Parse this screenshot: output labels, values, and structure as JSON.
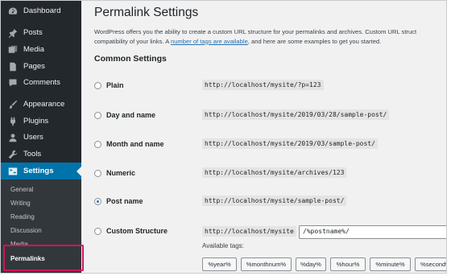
{
  "sidebar": {
    "items": [
      {
        "label": "Dashboard",
        "icon": "dashboard-icon"
      },
      {
        "label": "Posts",
        "icon": "pin-icon"
      },
      {
        "label": "Media",
        "icon": "media-icon"
      },
      {
        "label": "Pages",
        "icon": "pages-icon"
      },
      {
        "label": "Comments",
        "icon": "comments-icon"
      },
      {
        "label": "Appearance",
        "icon": "paintbrush-icon"
      },
      {
        "label": "Plugins",
        "icon": "plugin-icon"
      },
      {
        "label": "Users",
        "icon": "users-icon"
      },
      {
        "label": "Tools",
        "icon": "wrench-icon"
      },
      {
        "label": "Settings",
        "icon": "settings-icon"
      }
    ],
    "submenu": [
      "General",
      "Writing",
      "Reading",
      "Discussion",
      "Media",
      "Permalinks"
    ],
    "active_submenu": "Permalinks",
    "accent_color": "#0073aa",
    "highlight_color": "#d0155a"
  },
  "main": {
    "title": "Permalink Settings",
    "intro_line1": "WordPress offers you the ability to create a custom URL structure for your permalinks and archives. Custom URL struct",
    "intro_line2_pre": "compatibility of your links. A ",
    "intro_link": "number of tags are available",
    "intro_line2_post": ", and here are some examples to get you started.",
    "section_title": "Common Settings",
    "options": [
      {
        "label": "Plain",
        "example": "http://localhost/mysite/?p=123",
        "checked": false
      },
      {
        "label": "Day and name",
        "example": "http://localhost/mysite/2019/03/28/sample-post/",
        "checked": false
      },
      {
        "label": "Month and name",
        "example": "http://localhost/mysite/2019/03/sample-post/",
        "checked": false
      },
      {
        "label": "Numeric",
        "example": "http://localhost/mysite/archives/123",
        "checked": false
      },
      {
        "label": "Post name",
        "example": "http://localhost/mysite/sample-post/",
        "checked": true
      },
      {
        "label": "Custom Structure",
        "example": "http://localhost/mysite",
        "checked": false
      }
    ],
    "custom_value": "/%postname%/",
    "available_tags_label": "Available tags:",
    "tags": [
      "%year%",
      "%monthnum%",
      "%day%",
      "%hour%",
      "%minute%",
      "%second%"
    ]
  }
}
